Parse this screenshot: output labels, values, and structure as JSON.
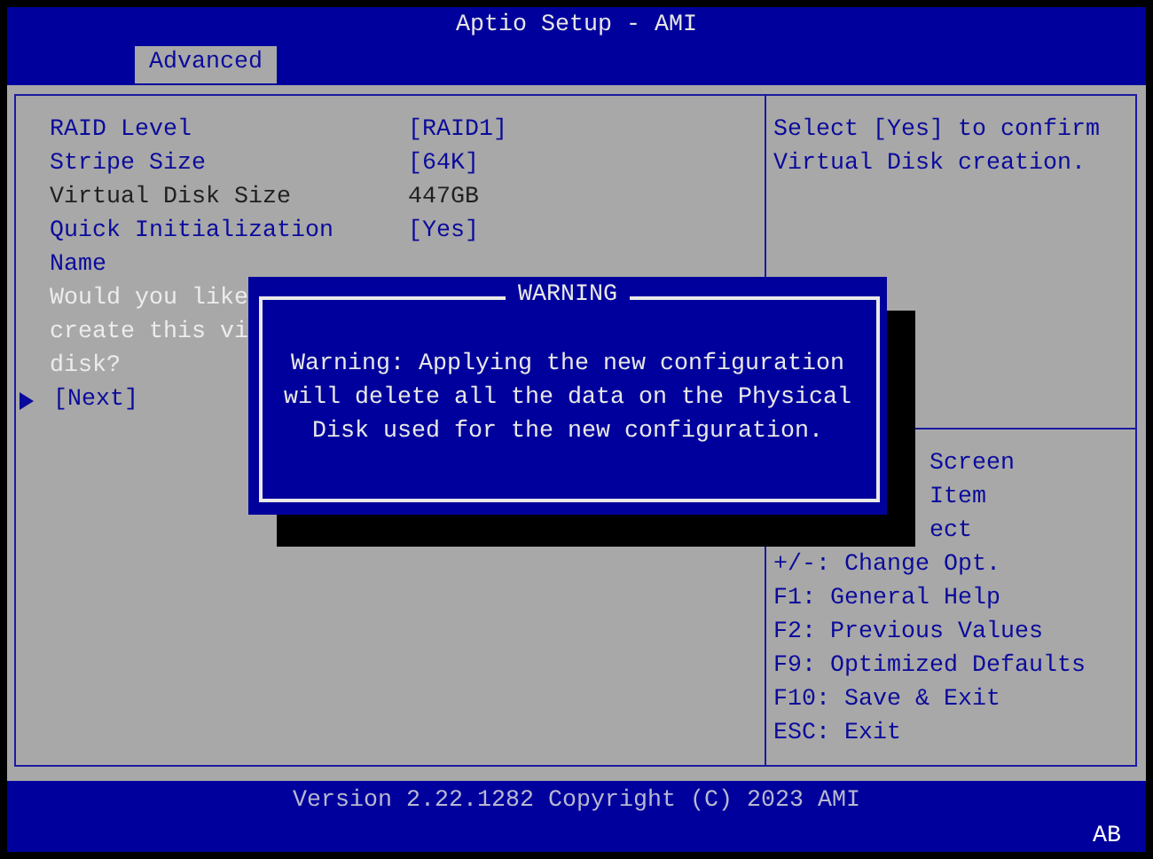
{
  "window": {
    "title": "Aptio Setup - AMI"
  },
  "tabs": [
    {
      "label": "Advanced",
      "selected": true
    }
  ],
  "settings": [
    {
      "kind": "option",
      "label": "RAID Level",
      "value": "[RAID1]"
    },
    {
      "kind": "option",
      "label": "Stripe Size",
      "value": "[64K]"
    },
    {
      "kind": "info",
      "label": "Virtual Disk Size",
      "value": "447GB"
    },
    {
      "kind": "option",
      "label": "Quick Initialization",
      "value": "[Yes]"
    },
    {
      "kind": "option",
      "label": "Name"
    },
    {
      "kind": "prompt",
      "label": "Would you like"
    },
    {
      "kind": "prompt",
      "label": "create this vi"
    },
    {
      "kind": "prompt",
      "label": "disk?"
    },
    {
      "kind": "submenu",
      "label": "[Next]"
    }
  ],
  "help_text": "Select [Yes] to confirm Virtual Disk creation.",
  "key_help": [
    {
      "kind": "partial",
      "text": "Screen"
    },
    {
      "kind": "partial",
      "text": "Item"
    },
    {
      "kind": "partial",
      "text": "ect"
    },
    {
      "kind": "full",
      "text": "+/-: Change Opt."
    },
    {
      "kind": "full",
      "text": "F1: General Help"
    },
    {
      "kind": "full",
      "text": "F2: Previous Values"
    },
    {
      "kind": "full",
      "text": "F9: Optimized Defaults"
    },
    {
      "kind": "full",
      "text": "F10: Save & Exit"
    },
    {
      "kind": "full",
      "text": "ESC: Exit"
    }
  ],
  "dialog": {
    "title": "WARNING",
    "message": "Warning: Applying the new configuration will delete all the data on the Physical Disk used for the new configuration."
  },
  "footer": {
    "version": "Version 2.22.1282 Copyright (C) 2023 AMI",
    "badge": "AB"
  }
}
